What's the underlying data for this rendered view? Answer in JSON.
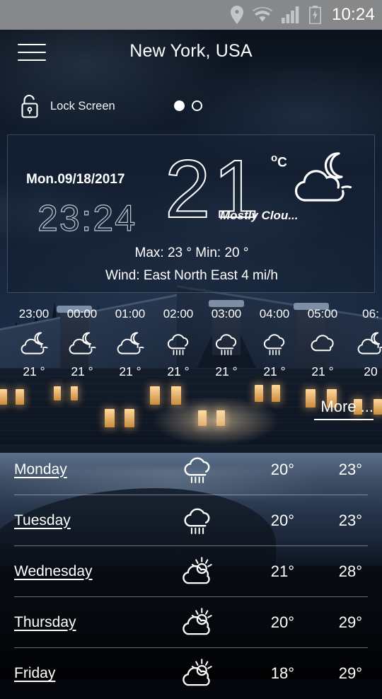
{
  "status_bar": {
    "time": "10:24",
    "icons": [
      "location-pin-icon",
      "wifi-icon",
      "signal-bars-icon",
      "battery-charging-icon"
    ]
  },
  "header": {
    "menu_icon": "hamburger-menu-icon",
    "city": "New York, USA",
    "lock_icon": "unlocked-padlock-icon",
    "lock_label": "Lock Screen",
    "page_indicator": {
      "total": 2,
      "active": 1
    }
  },
  "current": {
    "date": "Mon.09/18/2017",
    "clock": "23:24",
    "temperature": "21",
    "unit": "C",
    "unit_degree": "o",
    "condition": "Mostly Clou...",
    "condition_icon": "moon-cloud-icon",
    "max_min": "Max: 23 °  Min: 20 °",
    "wind": "Wind: East North East     4 mi/h"
  },
  "hourly": [
    {
      "time": "23:00",
      "icon": "moon-cloud-icon",
      "temp": "21 °"
    },
    {
      "time": "00:00",
      "icon": "moon-cloud-icon",
      "temp": "21 °"
    },
    {
      "time": "01:00",
      "icon": "moon-cloud-icon",
      "temp": "21 °"
    },
    {
      "time": "02:00",
      "icon": "rain-cloud-icon",
      "temp": "21 °"
    },
    {
      "time": "03:00",
      "icon": "rain-cloud-icon",
      "temp": "21 °"
    },
    {
      "time": "04:00",
      "icon": "rain-cloud-icon",
      "temp": "21 °"
    },
    {
      "time": "05:00",
      "icon": "cloud-icon",
      "temp": "21 °"
    },
    {
      "time": "06:",
      "icon": "moon-cloud-icon",
      "temp": "20"
    }
  ],
  "more": {
    "label": "More ..."
  },
  "daily": [
    {
      "day": "Monday",
      "icon": "rain-cloud-icon",
      "low": "20°",
      "high": "23°"
    },
    {
      "day": "Tuesday",
      "icon": "rain-cloud-icon",
      "low": "20°",
      "high": "23°"
    },
    {
      "day": "Wednesday",
      "icon": "sun-cloud-icon",
      "low": "21°",
      "high": "28°"
    },
    {
      "day": "Thursday",
      "icon": "sun-cloud-icon",
      "low": "20°",
      "high": "29°"
    },
    {
      "day": "Friday",
      "icon": "sun-cloud-icon",
      "low": "18°",
      "high": "29°"
    }
  ],
  "colors": {
    "status_bar_bg": "#86888a",
    "text": "#ffffff",
    "card_border": "rgba(150,175,205,0.30)"
  }
}
